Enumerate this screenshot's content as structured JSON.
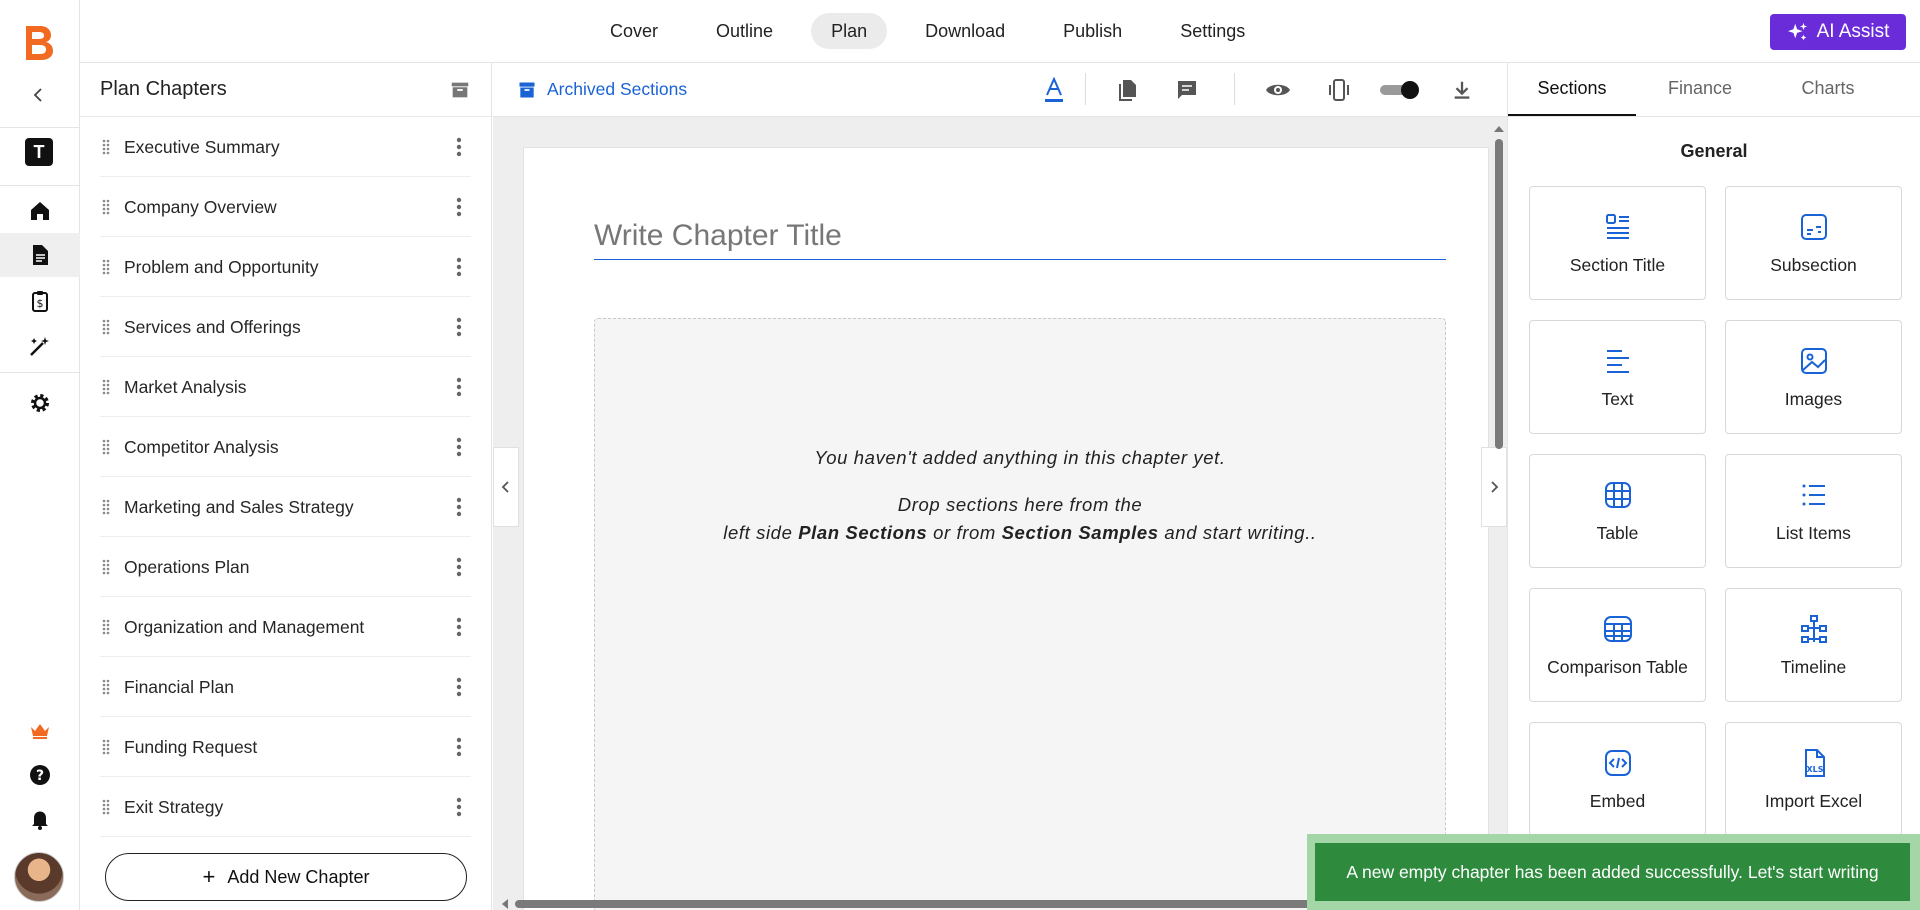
{
  "app": {
    "logo_letter": "B",
    "workspace_letter": "T"
  },
  "topnav": {
    "tabs": [
      {
        "label": "Cover"
      },
      {
        "label": "Outline"
      },
      {
        "label": "Plan",
        "active": true
      },
      {
        "label": "Download"
      },
      {
        "label": "Publish"
      },
      {
        "label": "Settings"
      }
    ],
    "ai_assist_label": "AI Assist",
    "ai_color": "#6a2bd9"
  },
  "chapters_panel": {
    "title": "Plan Chapters",
    "items": [
      {
        "label": "Executive Summary"
      },
      {
        "label": "Company Overview"
      },
      {
        "label": "Problem and Opportunity"
      },
      {
        "label": "Services and Offerings"
      },
      {
        "label": "Market Analysis"
      },
      {
        "label": "Competitor Analysis"
      },
      {
        "label": "Marketing and Sales Strategy"
      },
      {
        "label": "Operations Plan"
      },
      {
        "label": "Organization and Management"
      },
      {
        "label": "Financial Plan"
      },
      {
        "label": "Funding Request"
      },
      {
        "label": "Exit Strategy"
      }
    ],
    "add_button_label": "Add New Chapter"
  },
  "toolbar": {
    "archived_label": "Archived Sections",
    "accent": "#1a63d6"
  },
  "editor": {
    "title_placeholder": "Write Chapter Title",
    "empty_line1": "You haven't added anything in this chapter yet.",
    "empty_line2": "Drop sections here from the",
    "empty_line3_pre": "left side ",
    "empty_line3_b1": "Plan Sections",
    "empty_line3_mid": " or from ",
    "empty_line3_b2": "Section Samples",
    "empty_line3_post": " and start writing.."
  },
  "right_panel": {
    "tabs": [
      {
        "label": "Sections",
        "active": true
      },
      {
        "label": "Finance"
      },
      {
        "label": "Charts"
      }
    ],
    "group_title": "General",
    "tiles": [
      {
        "label": "Section Title",
        "icon": "section-title-icon"
      },
      {
        "label": "Subsection",
        "icon": "subsection-icon"
      },
      {
        "label": "Text",
        "icon": "text-icon"
      },
      {
        "label": "Images",
        "icon": "image-icon"
      },
      {
        "label": "Table",
        "icon": "table-icon"
      },
      {
        "label": "List Items",
        "icon": "list-icon"
      },
      {
        "label": "Comparison Table",
        "icon": "comparison-table-icon"
      },
      {
        "label": "Timeline",
        "icon": "timeline-icon"
      },
      {
        "label": "Embed",
        "icon": "embed-icon"
      },
      {
        "label": "Import Excel",
        "icon": "excel-icon"
      }
    ]
  },
  "toast": {
    "message": "A new empty chapter has been added successfully. Let's start writing",
    "color": "#2e8b3e"
  }
}
